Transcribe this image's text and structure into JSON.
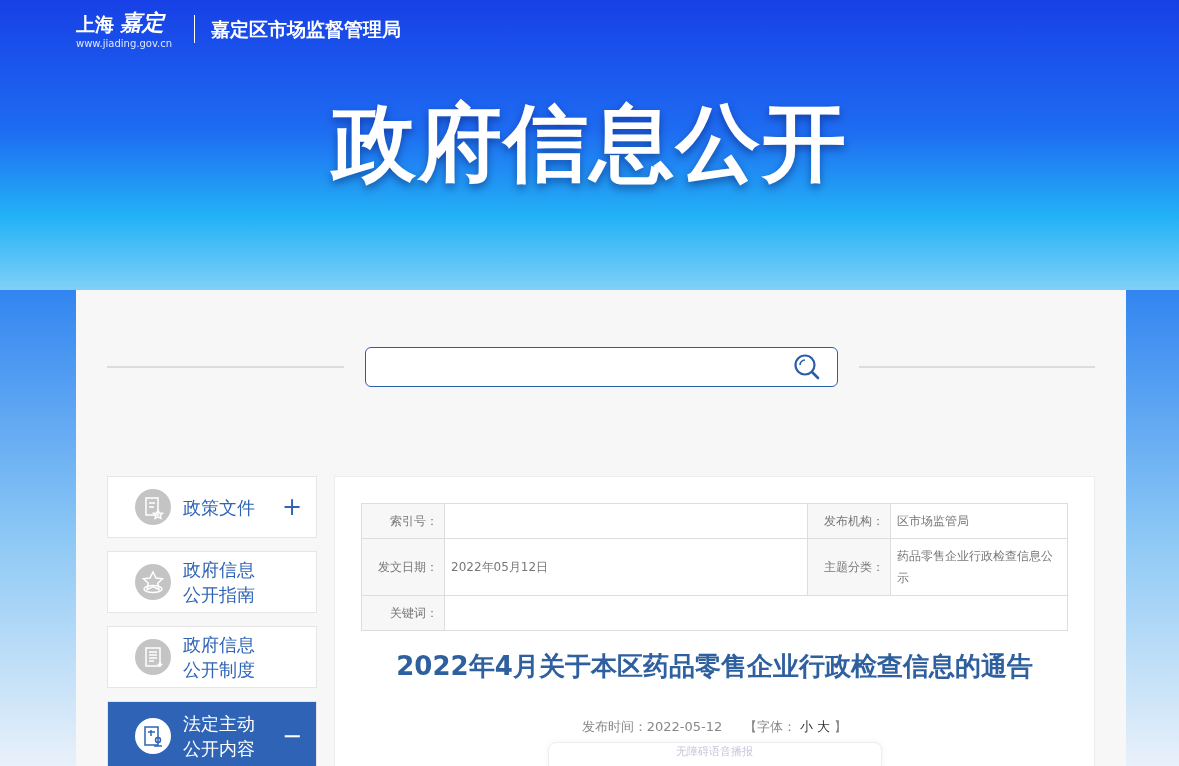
{
  "header": {
    "logo_text": "上海",
    "logo_script": "嘉定",
    "logo_url": "www.jiading.gov.cn",
    "site_title": "嘉定区市场监督管理局"
  },
  "banner": {
    "title": "政府信息公开"
  },
  "sidebar": {
    "items": [
      {
        "label": "政策文件",
        "kind": "policy",
        "toggle": "+",
        "selected": false
      },
      {
        "label": "政府信息公开指南",
        "kind": "guide",
        "selected": false
      },
      {
        "label": "政府信息公开制度",
        "kind": "rules",
        "selected": false
      },
      {
        "label": "法定主动公开内容",
        "kind": "statutory",
        "toggle": "−",
        "selected": true
      }
    ]
  },
  "info_table": {
    "rows": [
      [
        {
          "label": "索引号："
        },
        {
          "label": "发布机构：",
          "value": "区市场监管局"
        }
      ],
      [
        {
          "label": "发文日期：",
          "value": "2022年05月12日"
        },
        {
          "label": "主题分类：",
          "value": "药品零售企业行政检查信息公示"
        }
      ],
      [
        {
          "label": "关键词："
        }
      ]
    ]
  },
  "article": {
    "title": "2022年4月关于本区药品零售企业行政检查信息的通告",
    "publish_time": "发布时间：2022-05-12",
    "font_label": "【字体：",
    "font_small": "小",
    "font_large": "大",
    "font_end": "】",
    "audio_button": "无障碍语音播报"
  }
}
